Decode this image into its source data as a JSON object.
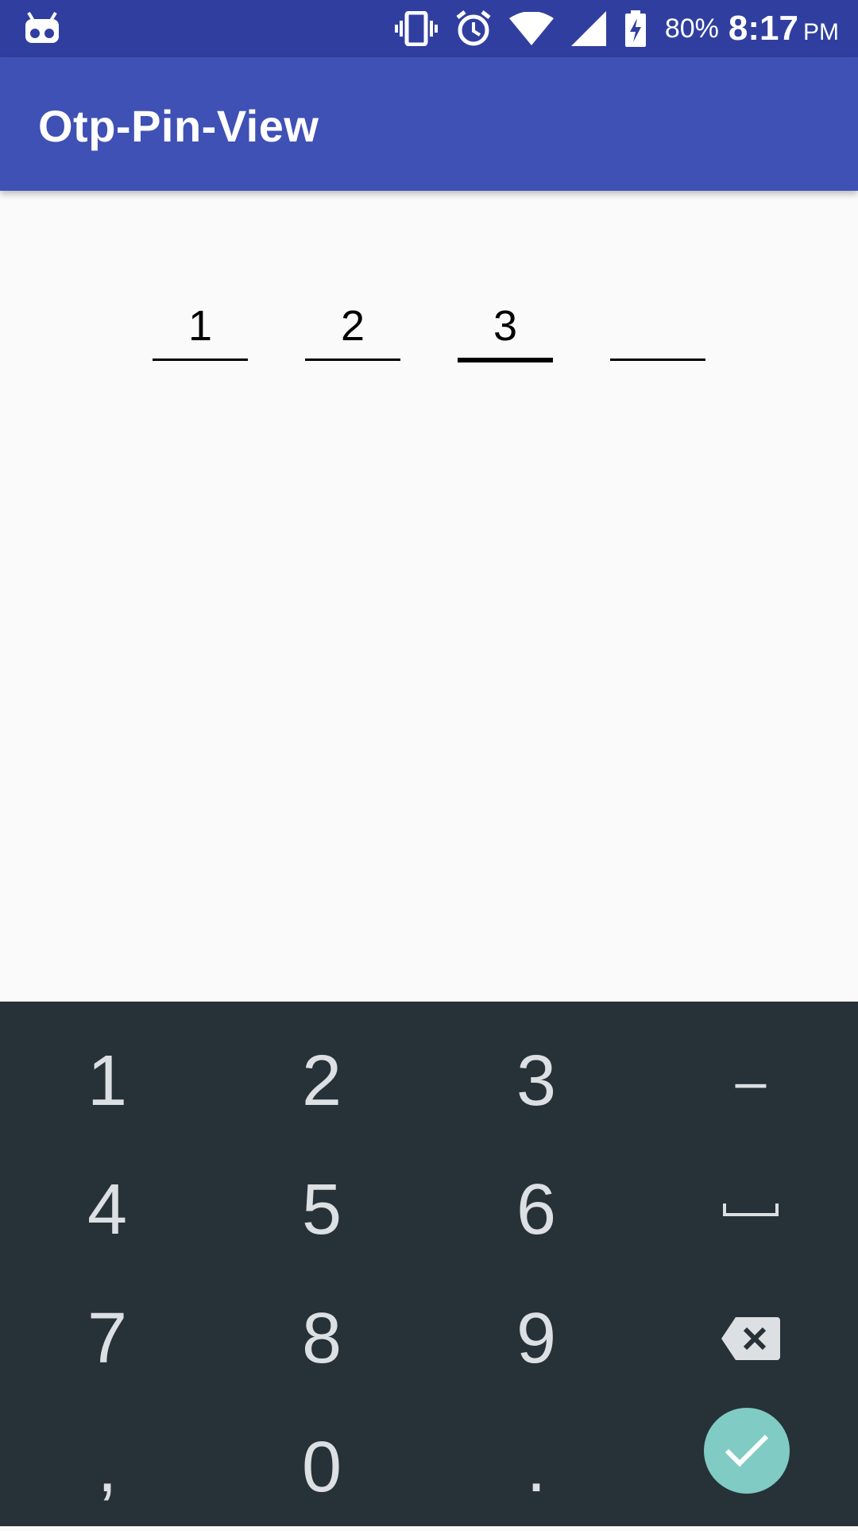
{
  "status_bar": {
    "battery_percent": "80%",
    "time": "8:17",
    "ampm": "PM",
    "icons": [
      "android-debug-icon",
      "vibrate-icon",
      "alarm-icon",
      "wifi-icon",
      "signal-icon",
      "battery-charging-icon"
    ]
  },
  "app_bar": {
    "title": "Otp-Pin-View",
    "color": "#3f51b5"
  },
  "otp": {
    "digits": [
      "1",
      "2",
      "3",
      ""
    ],
    "active_index": 2
  },
  "keyboard": {
    "rows": [
      [
        "1",
        "2",
        "3",
        "–"
      ],
      [
        "4",
        "5",
        "6",
        "space-icon"
      ],
      [
        "7",
        "8",
        "9",
        "backspace-icon"
      ],
      [
        ",",
        "0",
        ".",
        "done-check-icon"
      ]
    ],
    "accent": "#80cbc4",
    "background": "#263238"
  }
}
